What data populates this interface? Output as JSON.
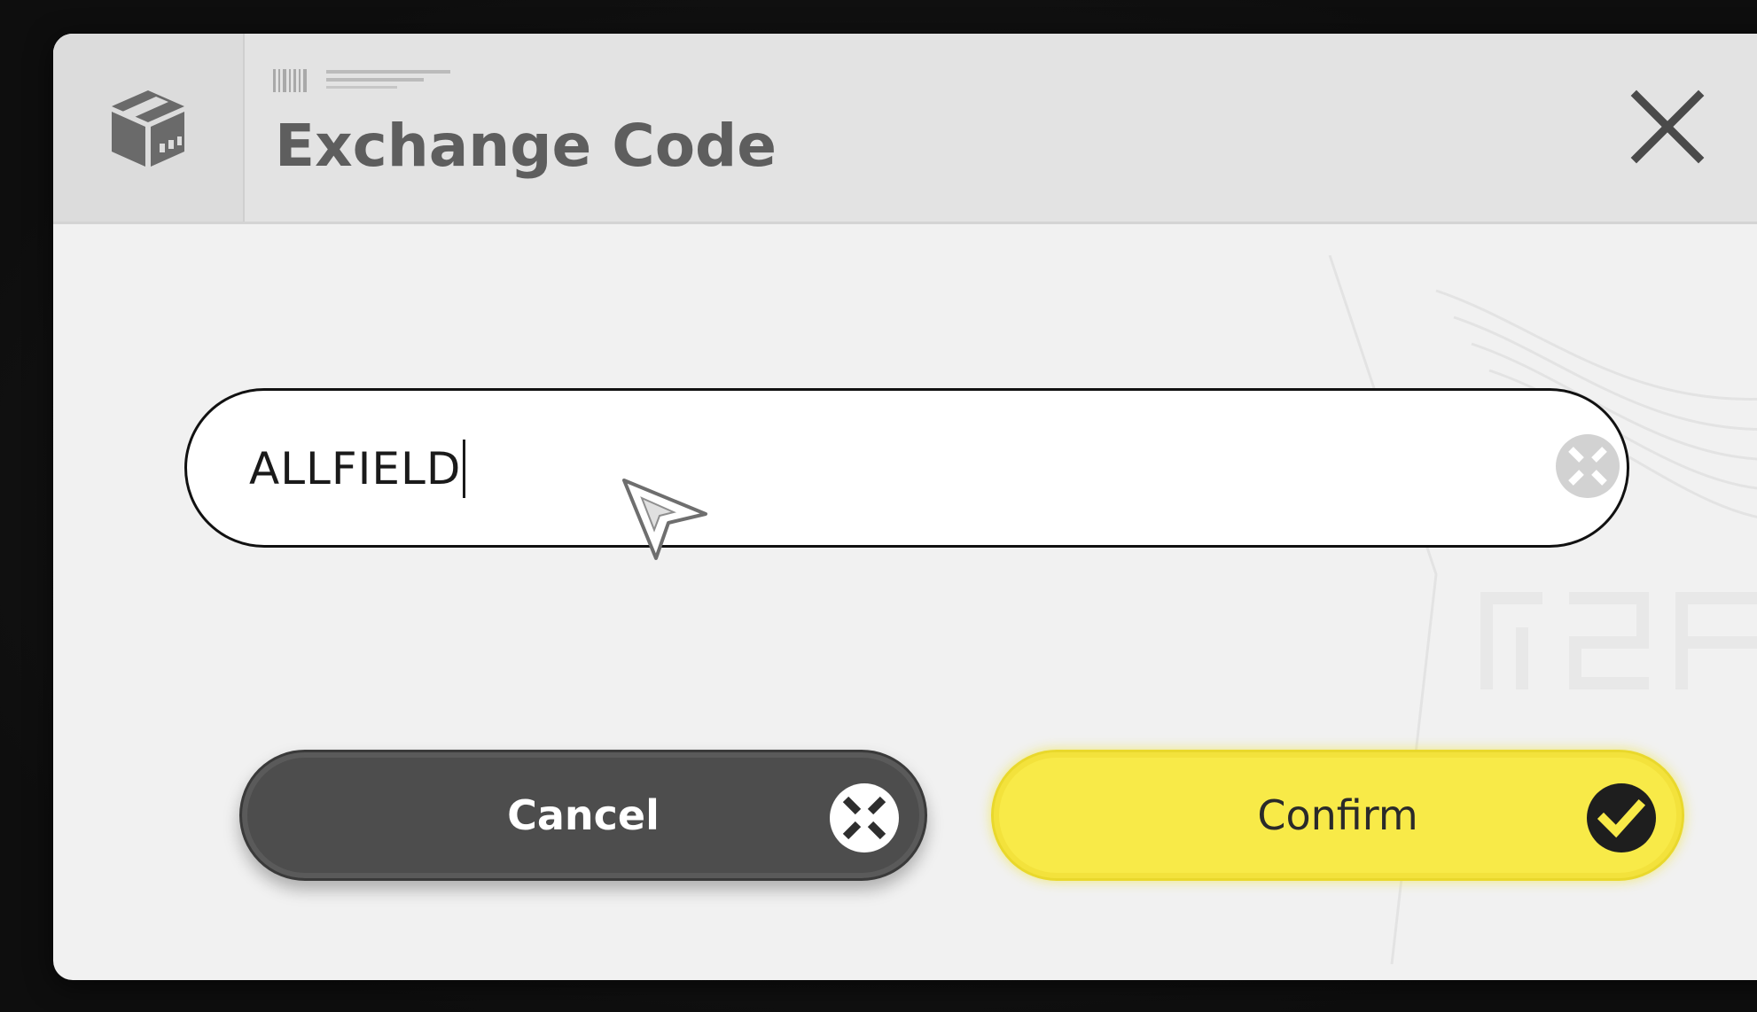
{
  "dialog": {
    "title": "Exchange Code",
    "header_icon": "package-icon",
    "close_icon": "close-icon"
  },
  "code_input": {
    "value": "ALLFIELD",
    "clear_icon": "clear-icon"
  },
  "buttons": {
    "cancel": {
      "label": "Cancel",
      "icon": "cancel-x-icon"
    },
    "confirm": {
      "label": "Confirm",
      "icon": "checkmark-icon"
    }
  },
  "colors": {
    "dialog_background": "#f1f1f1",
    "header_background": "#e3e3e3",
    "title_color": "#5e5e5e",
    "cancel_background": "#4d4d4d",
    "confirm_background": "#f8ea48"
  }
}
